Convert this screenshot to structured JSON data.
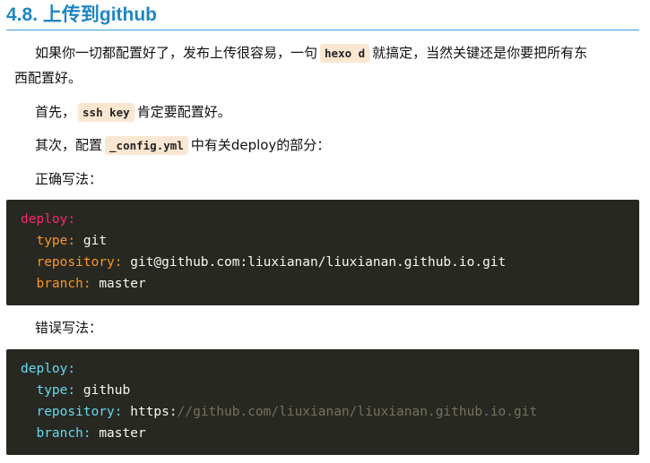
{
  "section": {
    "title": "4.8. 上传到github"
  },
  "paragraphs": {
    "intro_part1": "如果你一切都配置好了，发布上传很容易，一句",
    "intro_code": "hexo d",
    "intro_part2": "就搞定，当然关键还是你要把所有东",
    "intro_line2": "西配置好。",
    "first_part1": "首先，",
    "first_code": "ssh key",
    "first_part2": "肯定要配置好。",
    "second_part1": "其次，配置",
    "second_code": "_config.yml",
    "second_part2": "中有关deploy的部分：",
    "correct_label": "正确写法：",
    "wrong_label": "错误写法："
  },
  "code_correct": {
    "deploy_key": "deploy:",
    "type_key": "type:",
    "type_val": "git",
    "repo_key": "repository:",
    "repo_val": "git@github.com:liuxianan/liuxianan.github.io.git",
    "branch_key": "branch:",
    "branch_val": "master"
  },
  "code_wrong": {
    "deploy_key": "deploy:",
    "type_key": "type:",
    "type_val": "github",
    "repo_key": "repository:",
    "repo_val_scheme": "https:",
    "repo_val_rest": "//github.com/liuxianan/liuxianan.github.io.git",
    "branch_key": "branch:",
    "branch_val": "master"
  },
  "colors": {
    "heading": "#1f86c4",
    "heading_rule": "#3ea0d6",
    "inline_code_bg": "#fbe6d2",
    "code_bg": "#272822",
    "key_pink": "#f92672",
    "key_orange": "#fd971f",
    "key_cyan": "#66d9ef",
    "comment_grey": "#75715e"
  }
}
